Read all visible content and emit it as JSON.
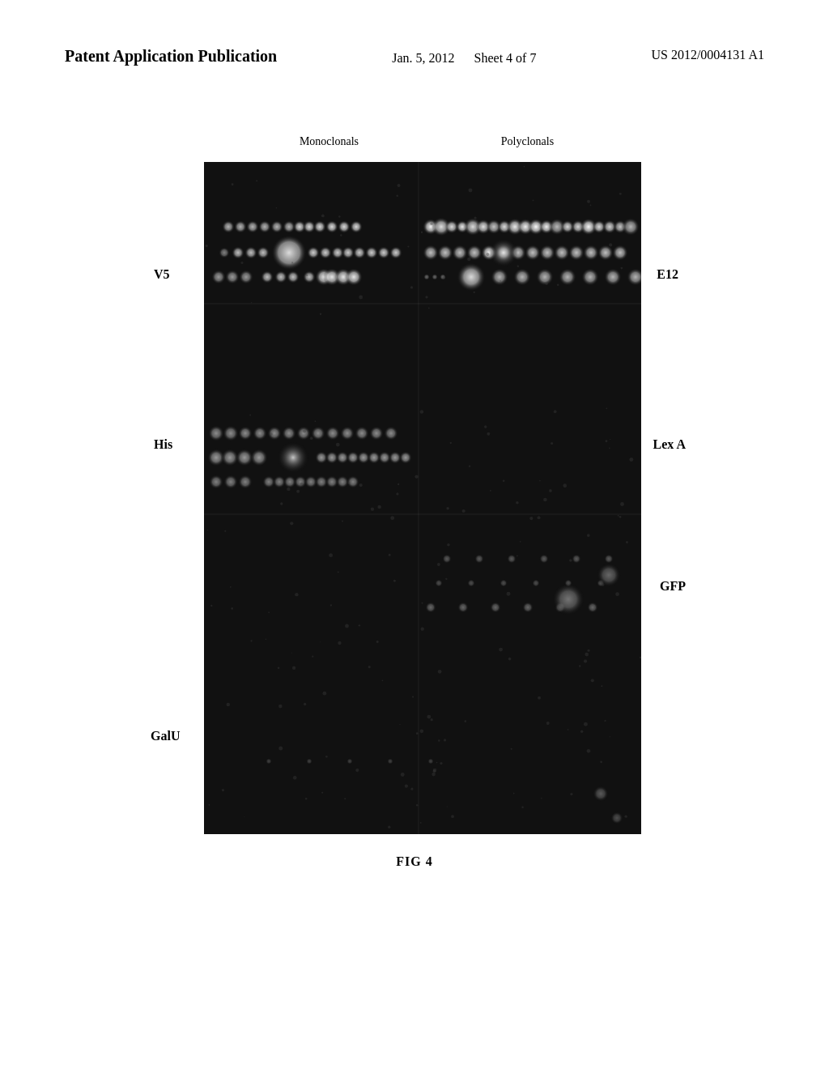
{
  "header": {
    "title": "Patent Application Publication",
    "date": "Jan. 5, 2012",
    "sheet": "Sheet 4 of 7",
    "patent_number": "US 2012/0004131 A1"
  },
  "figure": {
    "caption": "FIG 4",
    "labels": {
      "monoclonals": "Monoclonals",
      "polyclonals": "Polyclonals",
      "left": {
        "v5": "V5",
        "his": "His",
        "galu": "GalU"
      },
      "right": {
        "e12": "E12",
        "lexa": "Lex A",
        "gfp": "GFP"
      }
    }
  }
}
